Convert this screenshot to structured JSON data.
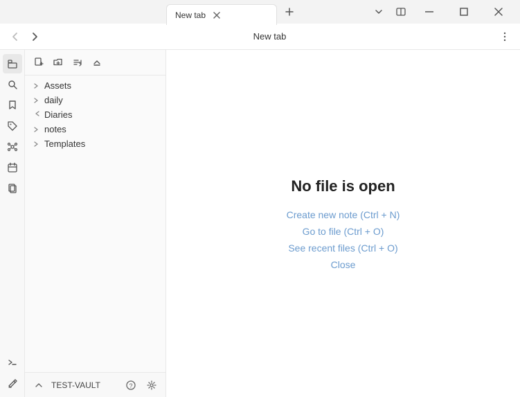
{
  "titlebar": {
    "tab_label": "New tab",
    "new_tab_icon": "+",
    "close_tab_icon": "✕",
    "split_icon": "⊡",
    "minimize_icon": "—",
    "maximize_icon": "□",
    "close_win_icon": "✕",
    "chevron_down": "˅",
    "split_view": "⊟"
  },
  "navbar": {
    "title": "New tab",
    "back_icon": "←",
    "forward_icon": "→",
    "menu_icon": "⋯"
  },
  "sidebar_icons": [
    {
      "name": "sidebar-icon-files",
      "icon": "folder",
      "active": true
    },
    {
      "name": "sidebar-icon-search",
      "icon": "search"
    },
    {
      "name": "sidebar-icon-bookmarks",
      "icon": "bookmark"
    },
    {
      "name": "sidebar-icon-tags",
      "icon": "tag"
    },
    {
      "name": "sidebar-icon-graph",
      "icon": "graph"
    },
    {
      "name": "sidebar-icon-calendar",
      "icon": "calendar"
    },
    {
      "name": "sidebar-icon-pages",
      "icon": "pages"
    },
    {
      "name": "sidebar-icon-terminal",
      "icon": "terminal"
    },
    {
      "name": "sidebar-icon-edit",
      "icon": "edit"
    }
  ],
  "explorer": {
    "toolbar": {
      "new_note": "new-note",
      "new_folder": "new-folder",
      "sort": "sort",
      "collapse": "collapse"
    },
    "tree": [
      {
        "label": "Assets",
        "expanded": false,
        "indent": 0
      },
      {
        "label": "daily",
        "expanded": false,
        "indent": 0
      },
      {
        "label": "Diaries",
        "expanded": true,
        "indent": 0
      },
      {
        "label": "notes",
        "expanded": false,
        "indent": 0
      },
      {
        "label": "Templates",
        "expanded": false,
        "indent": 0
      }
    ]
  },
  "vault": {
    "chevron": "⌃",
    "name": "TEST-VAULT",
    "help": "?",
    "settings": "⚙"
  },
  "content": {
    "no_file_title": "No file is open",
    "links": [
      {
        "label": "Create new note (Ctrl + N)",
        "name": "create-note-link"
      },
      {
        "label": "Go to file (Ctrl + O)",
        "name": "go-to-file-link"
      },
      {
        "label": "See recent files (Ctrl + O)",
        "name": "recent-files-link"
      },
      {
        "label": "Close",
        "name": "close-link"
      }
    ]
  }
}
